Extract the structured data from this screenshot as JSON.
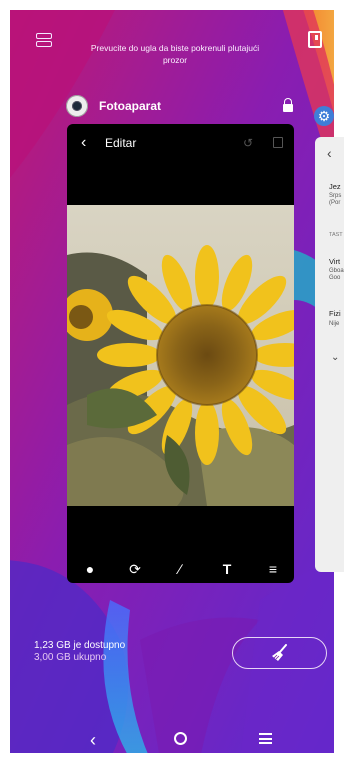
{
  "hint": {
    "line1": "Prevucite do ugla da biste pokrenuli plutajući",
    "line2": "prozor"
  },
  "app": {
    "name": "Fotoaparat"
  },
  "editor": {
    "title": "Editar",
    "tools": [
      "filters-icon",
      "crop-rotate-icon",
      "brush-icon",
      "text-icon",
      "adjust-icon"
    ]
  },
  "side_card": {
    "lines": [
      "Jez",
      "Srps",
      "(Por",
      "TAST",
      "Virt",
      "Gboa",
      "Goo",
      "Fizi",
      "Nije"
    ]
  },
  "memory": {
    "available": "1,23 GB je dostupno",
    "total": "3,00 GB ukupno"
  },
  "colors": {
    "wallpaper_purple": "#7a1aa8",
    "wallpaper_pink": "#d4157a",
    "wallpaper_orange": "#f5a623",
    "wallpaper_blue": "#3c6fe0",
    "gear_blue": "#3f7ed8"
  }
}
